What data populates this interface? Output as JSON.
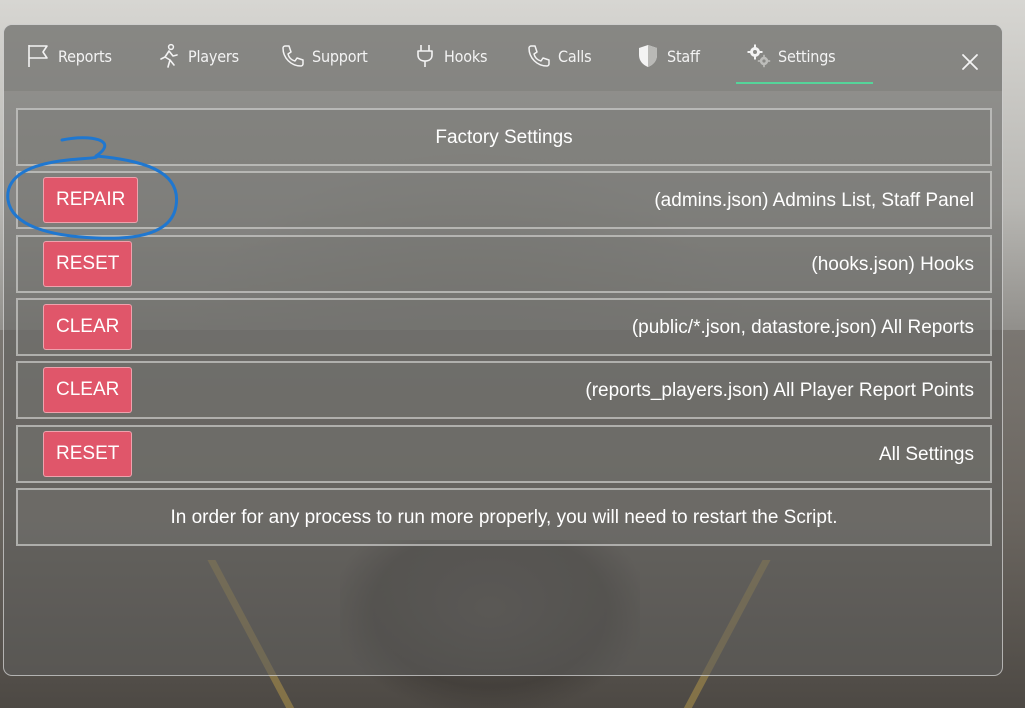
{
  "nav": {
    "tabs": [
      {
        "label": "Reports",
        "icon": "flag-icon"
      },
      {
        "label": "Players",
        "icon": "running-person-icon"
      },
      {
        "label": "Support",
        "icon": "phone-icon"
      },
      {
        "label": "Hooks",
        "icon": "plug-icon"
      },
      {
        "label": "Calls",
        "icon": "phone-icon"
      },
      {
        "label": "Staff",
        "icon": "shield-icon"
      },
      {
        "label": "Settings",
        "icon": "gears-icon",
        "active": true
      }
    ],
    "close_icon": "close-icon"
  },
  "header": {
    "title": "Factory Settings"
  },
  "rows": [
    {
      "button": "REPAIR",
      "description": "(admins.json) Admins List, Staff Panel"
    },
    {
      "button": "RESET",
      "description": "(hooks.json) Hooks"
    },
    {
      "button": "CLEAR",
      "description": "(public/*.json, datastore.json) All Reports"
    },
    {
      "button": "CLEAR",
      "description": "(reports_players.json) All Player Report Points"
    },
    {
      "button": "RESET",
      "description": "All Settings"
    }
  ],
  "footer": {
    "note": "In order for any process to run more properly, you will need to restart the Script."
  },
  "colors": {
    "accent_underline": "#55d49a",
    "button_red": "#e0566a",
    "annotation_blue": "#1f77d0"
  }
}
